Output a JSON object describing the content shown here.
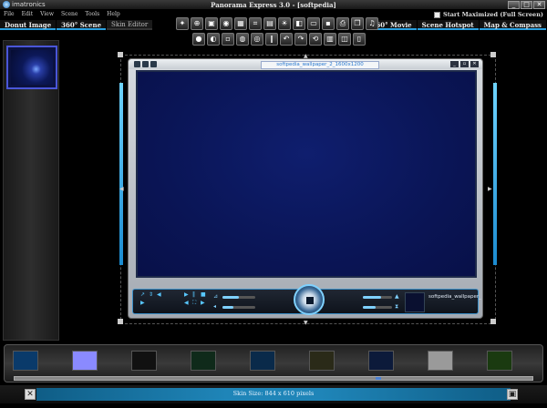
{
  "window": {
    "brand": "imatronics",
    "title": "Panorama Express 3.0 - [softpedia]",
    "controls": [
      "_",
      "□",
      "✕"
    ]
  },
  "menu": [
    "File",
    "Edit",
    "View",
    "Scene",
    "Tools",
    "Help"
  ],
  "start_maximized": {
    "label": "Start Maximized (Full Screen)",
    "checked": false
  },
  "left_tabs": [
    {
      "label": "Donut Image",
      "active": true
    },
    {
      "label": "360° Scene",
      "active": true
    },
    {
      "label": "Skin Editor",
      "active": false
    }
  ],
  "right_tabs": [
    {
      "label": "360° Movie"
    },
    {
      "label": "Scene Hotspot"
    },
    {
      "label": "Map & Compass"
    }
  ],
  "toolbar_icons_row1": [
    "wand-icon",
    "zoom-icon",
    "frame-icon",
    "eye-icon",
    "grid-icon",
    "crop-icon",
    "image-icon",
    "sun-icon",
    "layers-icon",
    "folder-icon",
    "save-icon",
    "print-icon",
    "copy-icon",
    "music-icon"
  ],
  "toolbar_icons_row2": [
    "circle-icon",
    "contrast-icon",
    "brightness-icon",
    "hue-icon",
    "color-icon",
    "pause-icon",
    "undo-icon",
    "redo-icon",
    "rotate-icon",
    "film-icon",
    "window-icon",
    "exit-icon"
  ],
  "skin": {
    "title": "softpedia_wallpaper_2_1600x1200",
    "mini_name": "softpedia_wallpaper_"
  },
  "filmstrip_thumbs": [
    {
      "color": "#0a3a6a"
    },
    {
      "color": "#8a8aff"
    },
    {
      "color": "#111111"
    },
    {
      "color": "#0f2a1a"
    },
    {
      "color": "#0a2a4a"
    },
    {
      "color": "#2a2a18"
    },
    {
      "color": "#0c1a3a"
    },
    {
      "color": "#9a9a9a"
    },
    {
      "color": "#1a3a10"
    }
  ],
  "status": {
    "text": "Skin Size: 844 x 610 pixels"
  }
}
